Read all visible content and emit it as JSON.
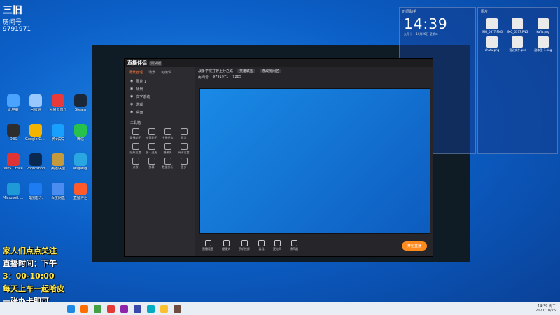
{
  "overlay": {
    "top_left": {
      "line1": "三旧",
      "line2": "房间号",
      "line3": "9791971"
    },
    "promo_lines": [
      {
        "text": "家人们点点关注",
        "color": "yellow"
      },
      {
        "text": "直播时间：下午",
        "color": "white"
      },
      {
        "text": "3：00-10:00",
        "color": "yellow"
      },
      {
        "text": "每天上车一起哈皮",
        "color": "yellow"
      },
      {
        "text": "一张办卡即可",
        "color": "white"
      }
    ]
  },
  "desktop_icons": [
    {
      "label": "此电脑",
      "color": "#4aa3ff"
    },
    {
      "label": "回收站",
      "color": "#9bc7ff"
    },
    {
      "label": "网易云音乐",
      "color": "#e83a3a"
    },
    {
      "label": "Steam",
      "color": "#1b2838"
    },
    {
      "label": "OBS",
      "color": "#2d2d2d"
    },
    {
      "label": "Google Chrome",
      "color": "#f2b400"
    },
    {
      "label": "腾讯QQ",
      "color": "#19a0ff"
    },
    {
      "label": "微信",
      "color": "#27c24c"
    },
    {
      "label": "WPS Office",
      "color": "#e03434"
    },
    {
      "label": "Photoshop",
      "color": "#0a2950"
    },
    {
      "label": "英雄联盟",
      "color": "#c49a3c"
    },
    {
      "label": "哔哩哔哩",
      "color": "#2aa6e0"
    },
    {
      "label": "Microsoft Edge",
      "color": "#1e9bd7"
    },
    {
      "label": "酷狗音乐",
      "color": "#1d7cf2"
    },
    {
      "label": "百度网盘",
      "color": "#4b8cf0"
    },
    {
      "label": "直播伴侣",
      "color": "#ff5a2a"
    }
  ],
  "app": {
    "title": "直播伴侣",
    "version": "测试版",
    "tabs": [
      "场景管理",
      "场景",
      "可编辑"
    ],
    "active_tab": 0,
    "scenes": [
      "图片 1",
      "场景",
      "文字滚动",
      "游戏",
      "桌面"
    ],
    "tools_title": "工具箱",
    "tools": [
      "录播助手",
      "房管助手",
      "主播任务",
      "玩法",
      "贴纸设置",
      "多人连麦",
      "摄像头",
      "高清设置",
      "点歌",
      "弹幕",
      "数据分析",
      "更多"
    ],
    "room": {
      "title": "战争学院打野上分之路 ",
      "category": "英雄联盟",
      "edit": "修改房间名",
      "room_id_label": "房间号",
      "room_id": "9791971",
      "viewers": "7285"
    },
    "bottom_buttons": [
      "直播设置",
      "摄像头",
      "手机投屏",
      "游戏",
      "麦克风",
      "扬声器"
    ],
    "start_label": "开始直播"
  },
  "widgets": {
    "clock": {
      "title": "时间助手",
      "time": "14:39",
      "sub": "九月十一  10月26日  星期二"
    },
    "files": {
      "title": "图片",
      "tabs": [
        "图片",
        "文档"
      ],
      "items": [
        "IMG_0377.PNG",
        "IMG_0377.PNG",
        "kafla.png",
        "zhutu.png",
        "设计文件.psd",
        "副本图-1.png"
      ]
    }
  },
  "taskbar": {
    "time": "14:39 周二",
    "date": "2021/10/26",
    "icons": [
      "#1e88e5",
      "#ff6f00",
      "#43a047",
      "#e53935",
      "#8e24aa",
      "#3949ab",
      "#00acc1",
      "#fbc02d",
      "#6d4c41"
    ]
  }
}
